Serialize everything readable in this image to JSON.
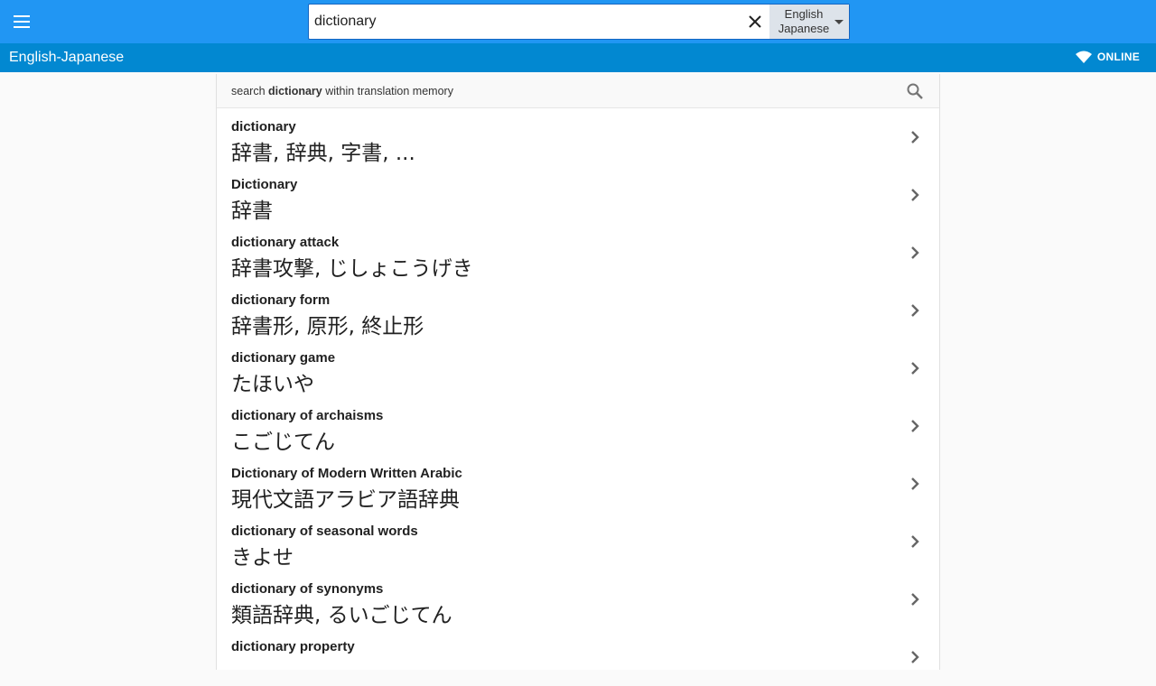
{
  "search": {
    "value": "dictionary",
    "language_top": "English",
    "language_bottom": "Japanese"
  },
  "subbar": {
    "title": "English-Japanese",
    "status": "ONLINE"
  },
  "memory": {
    "prefix": "search ",
    "term": "dictionary",
    "suffix": " within translation memory"
  },
  "results": [
    {
      "term": "dictionary",
      "translation": "辞書, 辞典, 字書, ..."
    },
    {
      "term": "Dictionary",
      "translation": "辞書"
    },
    {
      "term": "dictionary attack",
      "translation": "辞書攻撃, じしょこうげき"
    },
    {
      "term": "dictionary form",
      "translation": "辞書形, 原形, 終止形"
    },
    {
      "term": "dictionary game",
      "translation": "たほいや"
    },
    {
      "term": "dictionary of archaisms",
      "translation": "こごじてん"
    },
    {
      "term": "Dictionary of Modern Written Arabic",
      "translation": "現代文語アラビア語辞典"
    },
    {
      "term": "dictionary of seasonal words",
      "translation": "きよせ"
    },
    {
      "term": "dictionary of synonyms",
      "translation": "類語辞典, るいごじてん"
    },
    {
      "term": "dictionary property",
      "translation": ""
    }
  ],
  "colors": {
    "topbar": "#2196f3",
    "subbar": "#0288d1"
  },
  "icons": [
    "menu-icon",
    "close-icon",
    "dropdown-caret-icon",
    "wifi-icon",
    "search-icon",
    "chevron-right-icon"
  ]
}
